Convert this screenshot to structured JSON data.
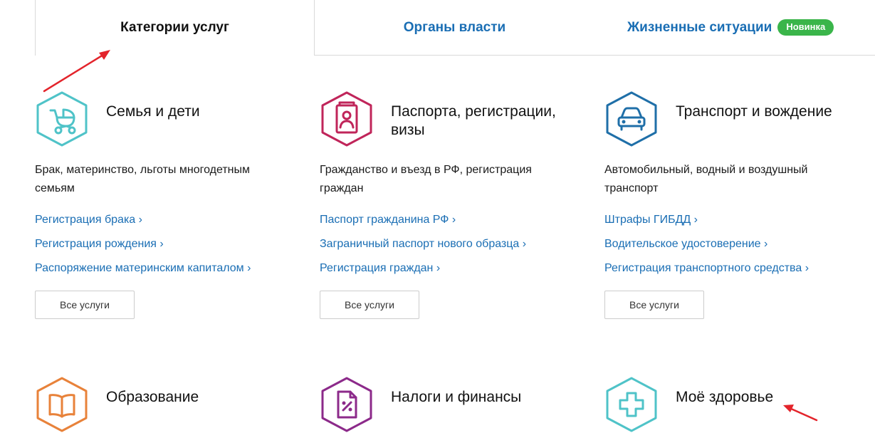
{
  "tabs": [
    {
      "label": "Категории услуг",
      "active": true
    },
    {
      "label": "Органы власти",
      "active": false
    },
    {
      "label": "Жизненные ситуации",
      "badge": "Новинка",
      "active": false
    }
  ],
  "colors": {
    "link": "#1a6eb4",
    "badge": "#3ab54a",
    "annotation_arrow": "#e3242b"
  },
  "cards": [
    {
      "icon": "stroller-icon",
      "color": "#4fc3c8",
      "title": "Семья и дети",
      "description": "Брак, материнство, льготы многодетным семьям",
      "links": [
        "Регистрация брака",
        "Регистрация рождения",
        "Распоряжение материнским капиталом"
      ],
      "button": "Все услуги"
    },
    {
      "icon": "passport-icon",
      "color": "#c0255a",
      "title": "Паспорта, регистрации, визы",
      "description": "Гражданство и въезд в РФ, регистрация граждан",
      "links": [
        "Паспорт гражданина РФ",
        "Заграничный паспорт нового образца",
        "Регистрация граждан"
      ],
      "button": "Все услуги"
    },
    {
      "icon": "car-icon",
      "color": "#1f6fa8",
      "title": "Транспорт и вождение",
      "description": "Автомобильный, водный и воздушный транспорт",
      "links": [
        "Штрафы ГИБДД",
        "Водительское удостоверение",
        "Регистрация транспортного средства"
      ],
      "button": "Все услуги"
    },
    {
      "icon": "book-icon",
      "color": "#e8823a",
      "title": "Образование"
    },
    {
      "icon": "tax-document-icon",
      "color": "#8c2a8a",
      "title": "Налоги и финансы"
    },
    {
      "icon": "medical-cross-icon",
      "color": "#4fc3c8",
      "title": "Моё здоровье"
    }
  ]
}
